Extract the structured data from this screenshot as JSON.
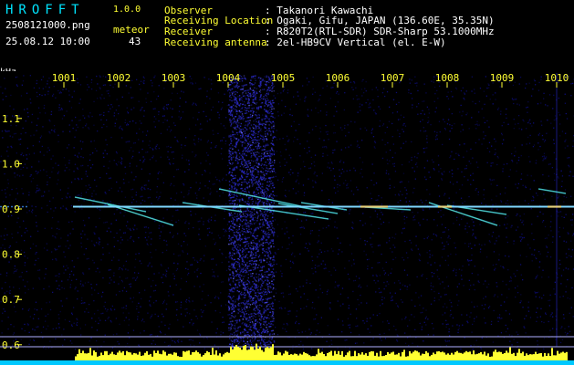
{
  "header": {
    "app_title": "HROFFT",
    "version": "1.0.0",
    "file_name": "2508121000.png",
    "timestamp": "25.08.12 10:00",
    "meteor_label": "meteor",
    "meteor_count": "43",
    "info": [
      {
        "key": "Observer",
        "value": ": Takanori Kawachi"
      },
      {
        "key": "Receiving Location",
        "value": ": Ogaki, Gifu, JAPAN (136.60E, 35.35N)"
      },
      {
        "key": "Receiver",
        "value": ": R820T2(RTL-SDR) SDR-Sharp 53.1000MHz"
      },
      {
        "key": "Receiving antenna",
        "value": ": 2el-HB9CV Vertical (el. E-W)"
      }
    ]
  },
  "colors": {
    "background": "#000000",
    "text_cyan": "#00e5ff",
    "text_yellow": "#ffff33",
    "text_white": "#ffffff",
    "noise": "#10109a",
    "activity_bar": "#ffff33",
    "baseline_bar": "#00c8ff"
  },
  "chart_data": {
    "type": "heatmap",
    "title": "",
    "xlabel": "",
    "ylabel": "kHz",
    "x_ticks": [
      "1001",
      "1002",
      "1003",
      "1004",
      "1005",
      "1006",
      "1007",
      "1008",
      "1009",
      "1010"
    ],
    "y_ticks": [
      "1.1",
      "1.0",
      "0.9",
      "0.8",
      "0.7",
      "0.6"
    ],
    "ylim": [
      0.6,
      1.15
    ],
    "carrier_khz": 0.905,
    "grid": false
  }
}
